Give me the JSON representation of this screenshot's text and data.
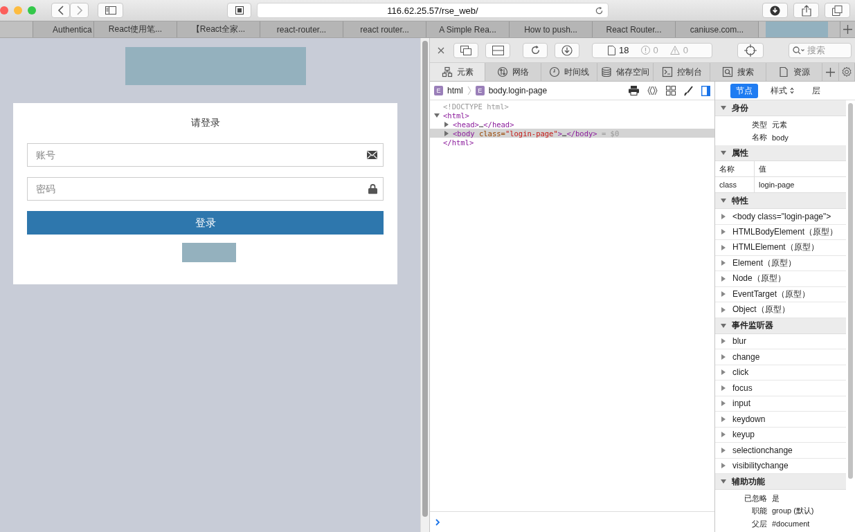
{
  "browser": {
    "url": "116.62.25.57/rse_web/",
    "tabs": [
      {
        "label": "Authentica",
        "selected": false
      },
      {
        "label": "React使用笔...",
        "selected": false
      },
      {
        "label": "【React全家...",
        "selected": false
      },
      {
        "label": "react-router...",
        "selected": false
      },
      {
        "label": "react router...",
        "selected": false
      },
      {
        "label": "A Simple Rea...",
        "selected": false
      },
      {
        "label": "How to push...",
        "selected": false
      },
      {
        "label": "React Router...",
        "selected": false
      },
      {
        "label": "caniuse.com...",
        "selected": false
      },
      {
        "kind": "redacted",
        "selected": true
      }
    ]
  },
  "page": {
    "login": {
      "title": "请登录",
      "fields": [
        {
          "kind": "email",
          "placeholder": "账号"
        },
        {
          "kind": "password",
          "placeholder": "密码"
        }
      ],
      "submit": "登录"
    }
  },
  "devtools": {
    "toolbar": {
      "resource_count": "18",
      "error_count": "0",
      "warning_count": "0",
      "search_placeholder": "搜索"
    },
    "tabs": [
      {
        "label": "元素",
        "selected": true
      },
      {
        "label": "网络",
        "selected": false
      },
      {
        "label": "时间线",
        "selected": false
      },
      {
        "label": "储存空间",
        "selected": false
      },
      {
        "label": "控制台",
        "selected": false
      },
      {
        "label": "搜索",
        "selected": false
      },
      {
        "label": "资源",
        "selected": false
      }
    ],
    "breadcrumb": [
      {
        "badge": "E",
        "label": "html"
      },
      {
        "badge": "E",
        "label": "body.login-page"
      }
    ],
    "dom_tree": [
      {
        "segments": [
          {
            "kind": "doctype",
            "text": "<!DOCTYPE html>"
          }
        ]
      },
      {
        "expanded": true,
        "selected": false,
        "segments": [
          {
            "kind": "tag",
            "text": "<html>"
          }
        ],
        "children": [
          {
            "expanded": false,
            "selected": false,
            "segments": [
              {
                "kind": "tag",
                "text": "<head>"
              },
              {
                "kind": "plain",
                "text": "…"
              },
              {
                "kind": "tag",
                "text": "</head>"
              }
            ]
          },
          {
            "expanded": false,
            "selected": true,
            "segments": [
              {
                "kind": "tag",
                "text": "<body"
              },
              {
                "kind": "attr",
                "text": " class="
              },
              {
                "kind": "value",
                "text": "\"login-page\""
              },
              {
                "kind": "tag",
                "text": ">"
              },
              {
                "kind": "plain",
                "text": "…"
              },
              {
                "kind": "tag",
                "text": "</body>"
              },
              {
                "kind": "ref",
                "text": " = $0"
              }
            ]
          }
        ],
        "closing": [
          {
            "kind": "tag",
            "text": "</html>"
          }
        ]
      }
    ],
    "sidebar": {
      "modes": [
        {
          "label": "节点",
          "selected": true
        },
        {
          "label": "样式",
          "selected": false
        },
        {
          "label": "层",
          "selected": false
        }
      ],
      "sections": [
        {
          "kind": "pairs",
          "title": "身份",
          "expanded": true,
          "rows": [
            {
              "label": "类型",
              "value": "元素"
            },
            {
              "label": "名称",
              "value": "body"
            }
          ]
        },
        {
          "kind": "table",
          "title": "属性",
          "expanded": true,
          "header": [
            "名称",
            "值"
          ],
          "rows": [
            [
              "class",
              "login-page"
            ]
          ]
        },
        {
          "kind": "list",
          "title": "特性",
          "expanded": true,
          "items": [
            "<body class=\"login-page\">",
            "HTMLBodyElement（原型）",
            "HTMLElement（原型）",
            "Element（原型）",
            "Node（原型）",
            "EventTarget（原型）",
            "Object（原型）"
          ]
        },
        {
          "kind": "list",
          "title": "事件监听器",
          "expanded": true,
          "items": [
            "blur",
            "change",
            "click",
            "focus",
            "input",
            "keydown",
            "keyup",
            "selectionchange",
            "visibilitychange"
          ]
        },
        {
          "kind": "pairs",
          "title": "辅助功能",
          "expanded": true,
          "rows": [
            {
              "label": "已忽略",
              "value": "是"
            },
            {
              "label": "职能",
              "value": "group (默认)"
            },
            {
              "label": "父层",
              "value": "#document"
            }
          ]
        }
      ]
    }
  }
}
